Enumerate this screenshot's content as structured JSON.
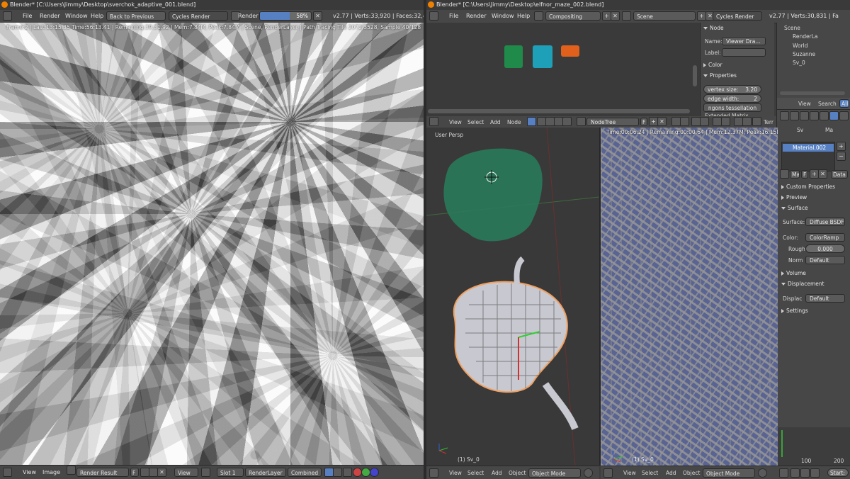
{
  "left_window": {
    "title": "Blender* [C:\\Users\\Jimmy\\Desktop\\sverchok_adaptive_001.blend]",
    "menu": [
      "File",
      "Render",
      "Window",
      "Help"
    ],
    "back_button": "Back to Previous",
    "engine": "Cycles Render",
    "render_label": "Render",
    "progress_text": "58%",
    "progress_fraction": 0.58,
    "stats": "v2.77 | Verts:33,920 | Faces:32,400 | T",
    "render_stats": "Frame:2 | Last:13:15.35 Time:56:13.41 | Remaining:39:31.92 | Mem:7.84M, Peak:7.84M | Scene, RenderLayer | Path Tracing Tile 2072/3528, Sample 40/128",
    "footer": {
      "view": "View",
      "image": "Image",
      "image_name": "Render Result",
      "f_label": "F",
      "view2": "View",
      "slot": "Slot 1",
      "layer": "RenderLayer",
      "pass": "Combined"
    }
  },
  "right_window": {
    "title": "Blender* [C:\\Users\\Jimmy\\Desktop\\elfnor_maze_002.blend]",
    "menu": [
      "File",
      "Render",
      "Window",
      "Help"
    ],
    "screen": "Compositing",
    "scene": "Scene",
    "engine": "Cycles Render",
    "stats": "v2.77 | Verts:30,831 | Fa",
    "node_panel": {
      "section": "Node",
      "name_label": "Name:",
      "name_value": "Viewer Dra...",
      "label_label": "Label:",
      "color_section": "Color",
      "properties_section": "Properties",
      "vertex_size_label": "vertex size:",
      "vertex_size_value": "3.20",
      "edge_width_label": "edge width:",
      "edge_width_value": "2",
      "ngons_label": "ngons tessellation",
      "extended_label": "Extended Matrix"
    },
    "outliner": {
      "items": [
        "Scene",
        "RenderLa",
        "World",
        "Suzanne",
        "Sv_0"
      ]
    },
    "node_header": {
      "view": "View",
      "select": "Select",
      "add": "Add",
      "node": "Node",
      "tree": "NodeTree",
      "f_label": "F",
      "extra": "Terr"
    },
    "viewport": {
      "label": "User Persp",
      "object": "(1) Sv_0"
    },
    "render": {
      "stats": "Time:00:06.24 | Remaining:00:00.64 | Mem:12.37M, Peak:16.15M | Path T",
      "object": "(1) Sv_0"
    },
    "props_header": {
      "view": "View",
      "search": "Search",
      "all": "All"
    },
    "material": {
      "breadcrumb_a": "Sv",
      "breadcrumb_b": "Ma",
      "slot_name": "Material.002",
      "mat_field": "Ma",
      "f_label": "F",
      "data_label": "Data",
      "custom_properties": "Custom Properties",
      "preview": "Preview",
      "surface_section": "Surface",
      "surface_label": "Surface:",
      "surface_value": "Diffuse BSDF",
      "color_label": "Color:",
      "color_value": "ColorRamp",
      "rough_label": "Rough",
      "rough_value": "0.000",
      "norm_label": "Norm",
      "norm_value": "Default",
      "volume": "Volume",
      "displacement": "Displacement",
      "displac_label": "Displac",
      "displac_value": "Default",
      "settings": "Settings"
    },
    "timeline": {
      "tick_100": "100",
      "tick_200": "200",
      "start_label": "Start:"
    },
    "footer_3d": {
      "view": "View",
      "select": "Select",
      "add": "Add",
      "object": "Object",
      "mode": "Object Mode"
    },
    "footer_render": {
      "view": "View",
      "select": "Select",
      "add": "Add",
      "object": "Object",
      "mode": "Object Mode"
    }
  },
  "colors": {
    "header_bg": "#474747",
    "blender_orange": "#f08000",
    "selection_blue": "#5680c2",
    "mesh_orange": "#f0a060",
    "maze_blue": "#5a6492"
  }
}
